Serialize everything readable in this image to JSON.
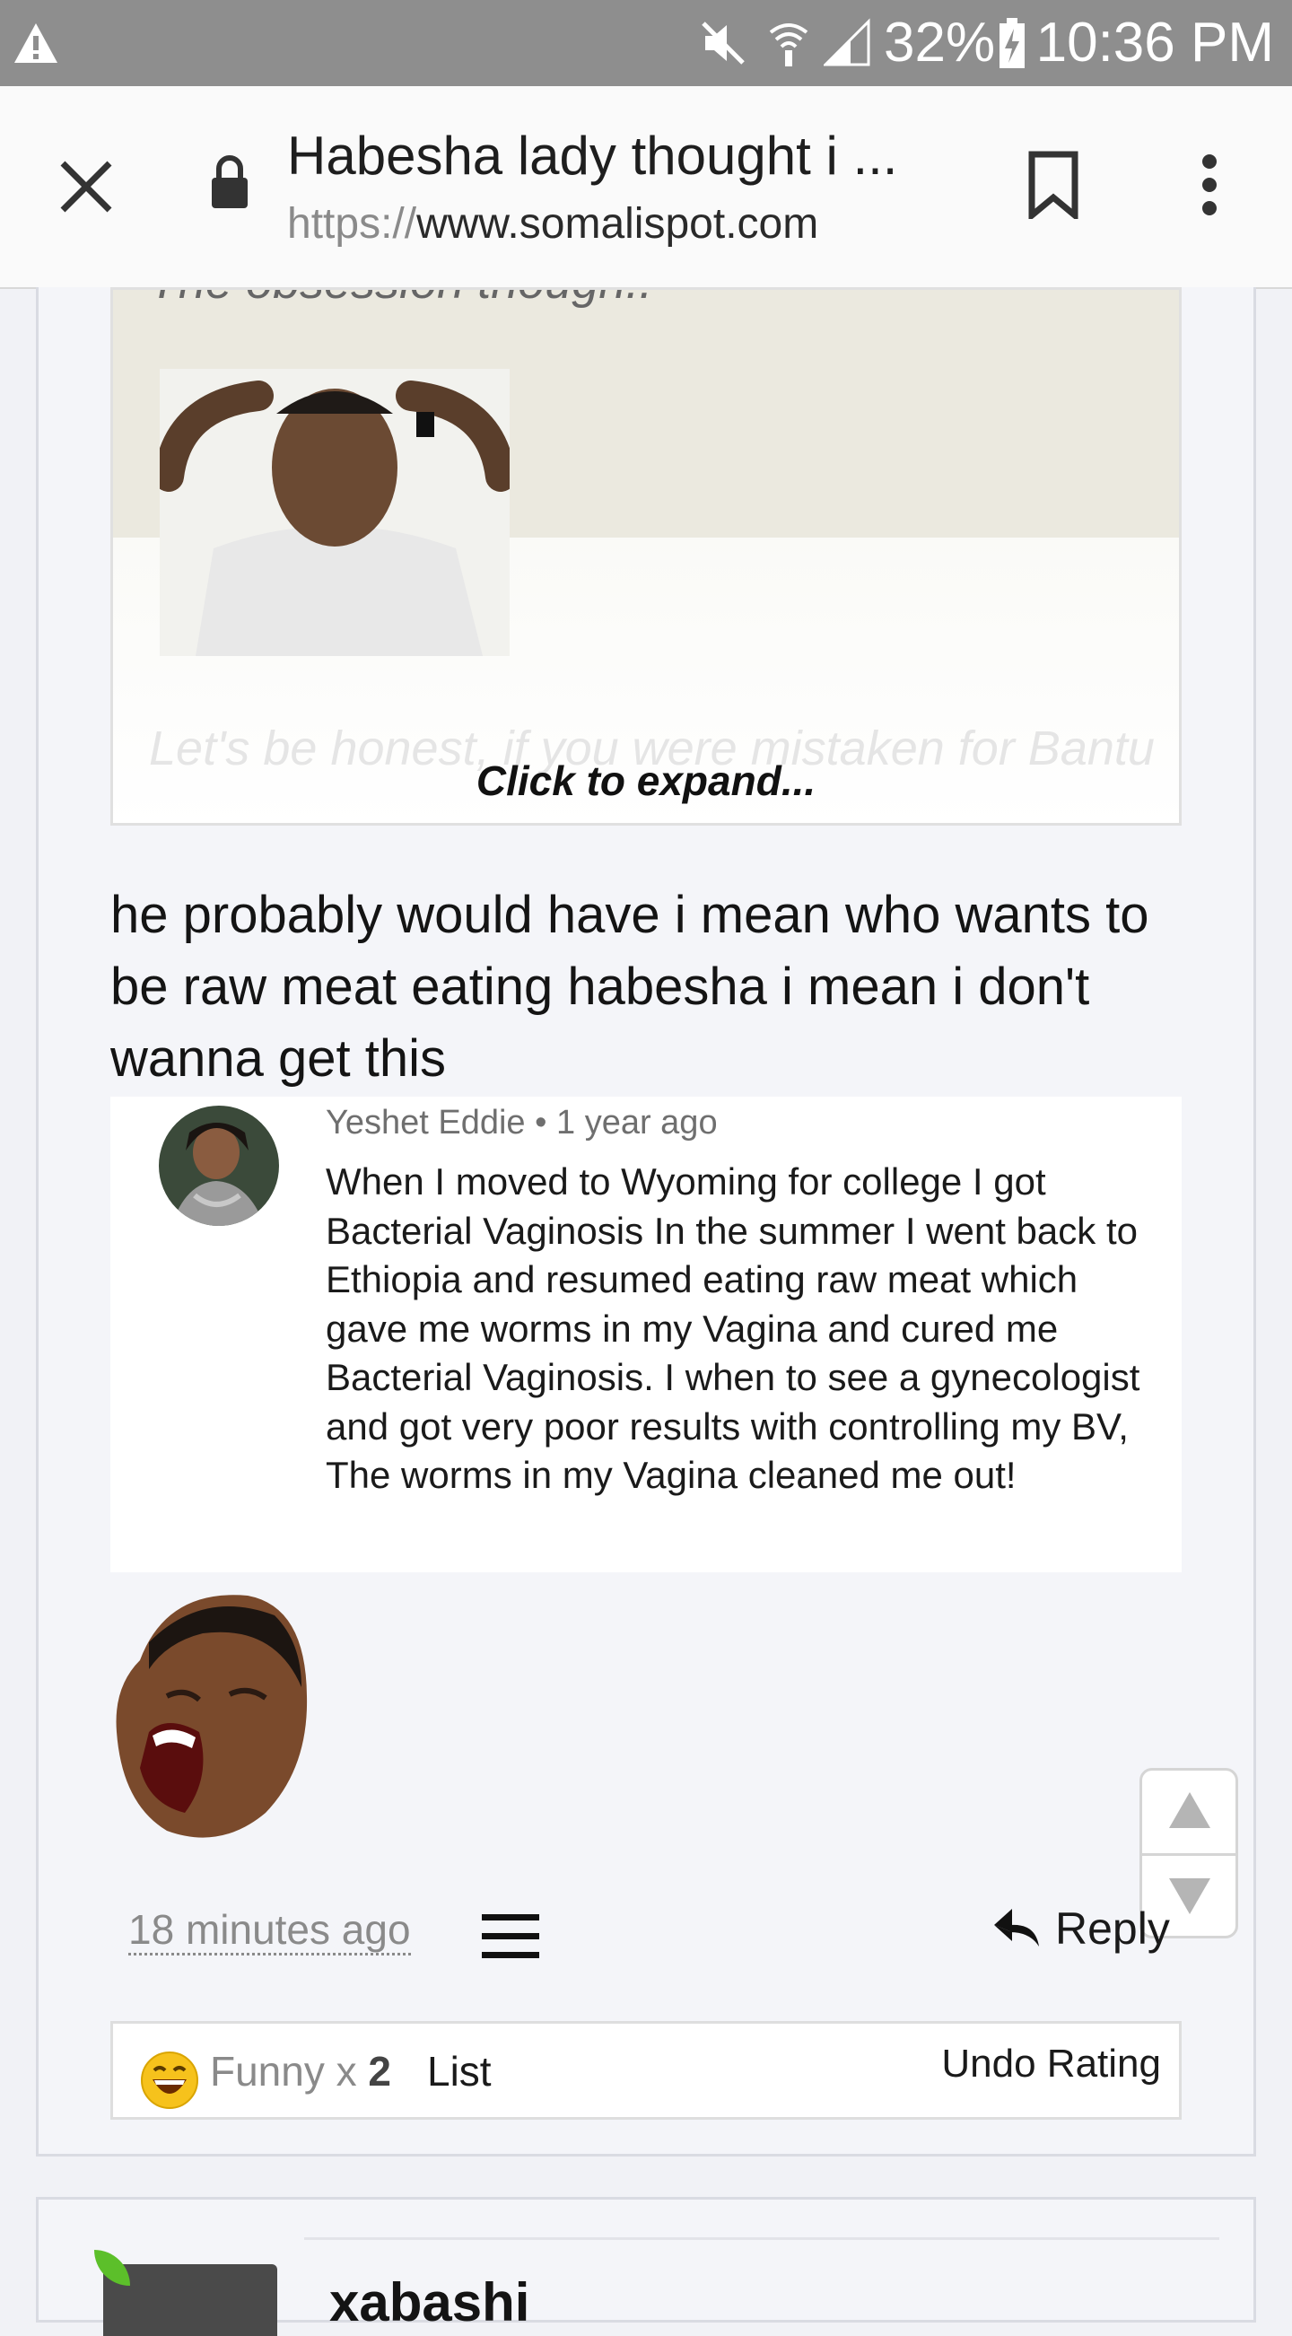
{
  "status_bar": {
    "battery": "32%",
    "time": "10:36 PM"
  },
  "browser": {
    "title": "Habesha lady thought i ...",
    "url_scheme": "https://",
    "url_host": "www.somalispot.com"
  },
  "quote": {
    "cut_text": "The obsession though..",
    "faded_text": "Let's be honest, if you were mistaken for Bantu",
    "expand_label": "Click to expand..."
  },
  "post": {
    "body": "he probably would have i mean who wants to be raw meat eating habesha i mean i don't wanna get this"
  },
  "embedded_comment": {
    "author": "Yeshet Eddie",
    "age": "1 year ago",
    "text": "When I moved to Wyoming for college I got Bacterial Vaginosis In the summer I went back to Ethiopia and resumed eating raw meat which gave me worms in my Vagina and cured me Bacterial Vaginosis. I when to see a gynecologist and got very poor results with controlling my BV, The worms in my Vagina cleaned me out!"
  },
  "footer": {
    "time": "18 minutes ago",
    "reply_label": "Reply"
  },
  "ratings": {
    "label": "Funny x",
    "count": "2",
    "list_label": "List",
    "undo_label": "Undo Rating"
  },
  "next_post": {
    "username": "xabashi"
  }
}
